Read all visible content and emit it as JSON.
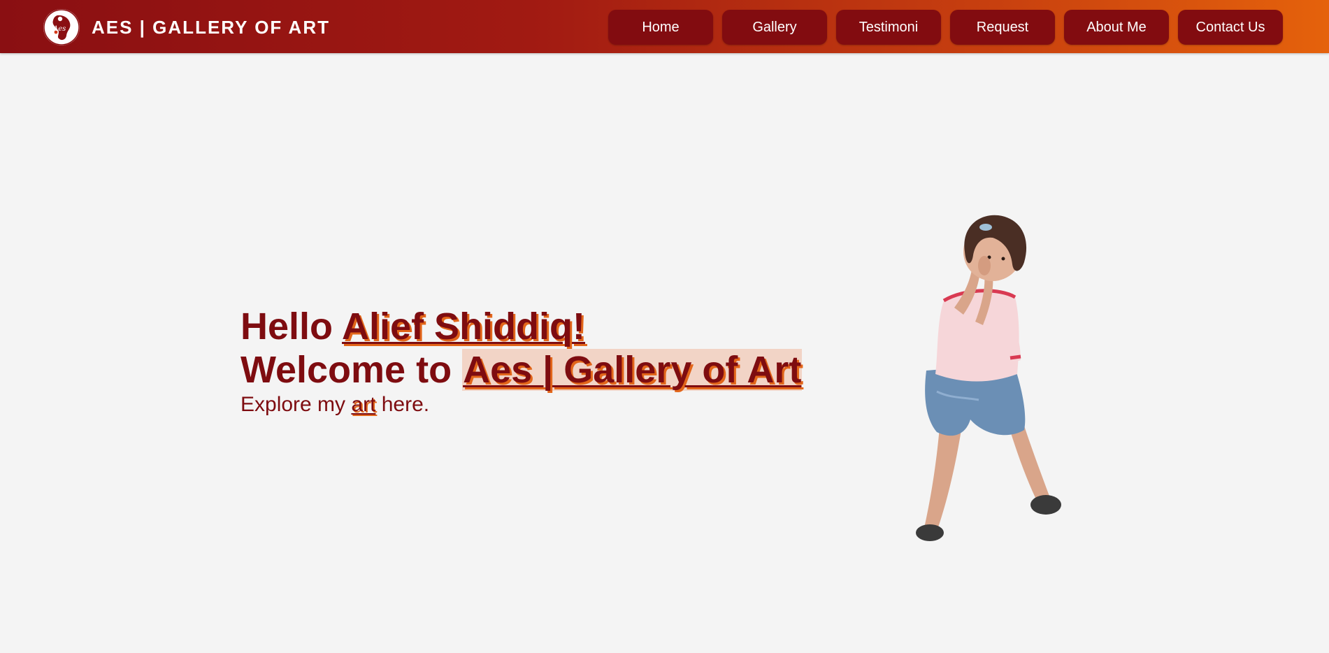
{
  "header": {
    "brand": "AES | GALLERY OF ART",
    "logo_text": "Aes"
  },
  "nav": {
    "items": [
      {
        "label": "Home"
      },
      {
        "label": "Gallery"
      },
      {
        "label": "Testimoni"
      },
      {
        "label": "Request"
      },
      {
        "label": "About Me"
      },
      {
        "label": "Contact Us"
      }
    ]
  },
  "hero": {
    "greeting_prefix": "Hello ",
    "user_name": "Alief Shiddiq!",
    "welcome_prefix": "Welcome to ",
    "site_name": "Aes | Gallery of Art",
    "explore_prefix": "Explore my ",
    "explore_link": "art",
    "explore_suffix": " here."
  },
  "colors": {
    "accent_dark": "#820c10",
    "accent_orange": "#e5620c",
    "background": "#f4f4f4"
  }
}
